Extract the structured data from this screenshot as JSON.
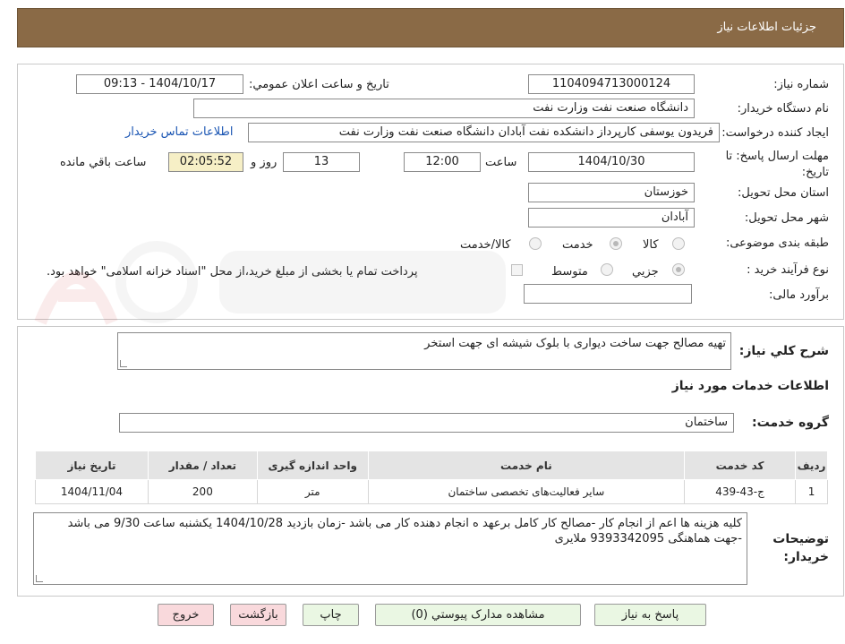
{
  "header": {
    "title": "جزئیات اطلاعات نیاز"
  },
  "fields": {
    "need_number_label": "شماره نیاز:",
    "need_number": "1104094713000124",
    "announce_label": "تاریخ و ساعت اعلان عمومي:",
    "announce_value": "1404/10/17 - 09:13",
    "buyer_org_label": "نام دستگاه خریدار:",
    "buyer_org": "دانشگاه صنعت نفت وزارت نفت",
    "requester_label": "ایجاد کننده درخواست:",
    "requester": "فریدون یوسفی کارپرداز دانشکده نفت آبادان دانشگاه صنعت نفت وزارت نفت",
    "contact_link": "اطلاعات تماس خریدار",
    "deadline_label": "مهلت ارسال پاسخ: تا تاریخ:",
    "deadline_date": "1404/10/30",
    "time_label": "ساعت",
    "deadline_time": "12:00",
    "days_value": "13",
    "days_label": "روز و",
    "remaining_value": "02:05:52",
    "remaining_label": "ساعت باقي مانده",
    "province_label": "استان محل تحویل:",
    "province": "خوزستان",
    "city_label": "شهر محل تحویل:",
    "city": "آبادان",
    "category_label": "طبقه بندی موضوعی:",
    "category_options": {
      "goods": "کالا",
      "service": "خدمت",
      "goods_service": "کالا/خدمت"
    },
    "process_label": "نوع فرآیند خرید :",
    "process_options": {
      "partial": "جزیي",
      "medium": "متوسط"
    },
    "payment_note": "پرداخت تمام یا بخشی از مبلغ خرید،از محل \"اسناد خزانه اسلامی\" خواهد بود.",
    "budget_label": "برآورد مالی:",
    "budget_value": ""
  },
  "description": {
    "label": "شرح کلي نیاز:",
    "text": "تهیه مصالح   جهت ساخت دیواری با بلوک  شیشه ای جهت استخر"
  },
  "services_section": {
    "title": "اطلاعات خدمات مورد نیاز",
    "group_label": "گروه خدمت:",
    "group_value": "ساختمان"
  },
  "table": {
    "headers": [
      "ردیف",
      "کد خدمت",
      "نام خدمت",
      "واحد اندازه گیری",
      "تعداد / مقدار",
      "تاریخ نیاز"
    ],
    "rows": [
      {
        "row": "1",
        "code": "ج-43-439",
        "name": "سایر فعالیت‌های تخصصی ساختمان",
        "unit": "متر",
        "qty": "200",
        "date": "1404/11/04"
      }
    ]
  },
  "buyer_notes": {
    "label": "توضیحات خریدار:",
    "text": "کلیه  هزینه ها اعم از انجام کار -مصالح کار  کامل برعهد ه انجام دهنده کار می باشد -زمان بازدید 1404/10/28 یکشنبه ساعت 9/30 می باشد -جهت هماهنگی 9393342095 ملایری"
  },
  "buttons": {
    "reply": "پاسخ به نیاز",
    "view_docs": "مشاهده مدارک پیوستي (0)",
    "print": "چاپ",
    "back": "بازگشت",
    "exit": "خروج"
  },
  "colors": {
    "header_bg": "#8a6a46",
    "link": "#1a55b3",
    "timer_bg": "#f6efc6",
    "button_green": "#eaf7e3",
    "button_pink": "#f9d9dc"
  }
}
